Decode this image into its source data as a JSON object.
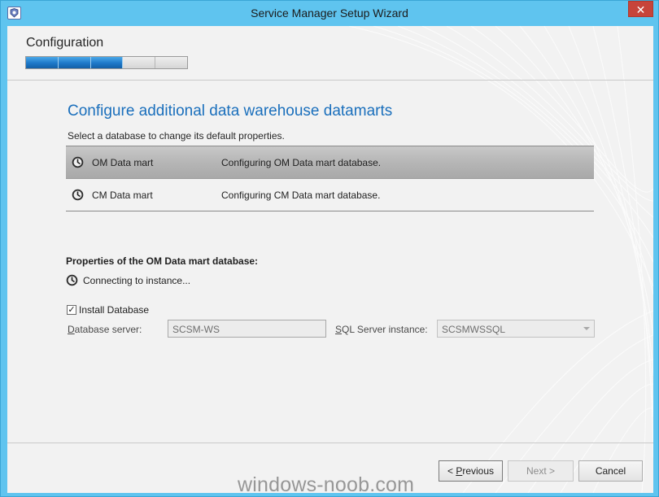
{
  "window": {
    "title": "Service Manager Setup Wizard",
    "close_glyph": "✕",
    "accent_color": "#5fc4ef",
    "icon": "service-manager-app-icon"
  },
  "header": {
    "step_label": "Configuration",
    "progress": {
      "completed_steps": 3,
      "total_steps": 5,
      "fill_color": "#1d78c9"
    }
  },
  "main": {
    "title": "Configure additional data warehouse datamarts",
    "description": "Select a database to change its default properties.",
    "datamarts": [
      {
        "name": "OM Data mart",
        "status": "Configuring OM Data mart database.",
        "icon": "clock-icon",
        "selected": true
      },
      {
        "name": "CM Data mart",
        "status": "Configuring CM Data mart database.",
        "icon": "clock-icon",
        "selected": false
      }
    ],
    "properties": {
      "title": "Properties of the OM Data mart database:",
      "connecting_text": "Connecting to instance...",
      "install_database_label": "Install Database",
      "install_database_checked": true,
      "database_server": {
        "label_underlined": "D",
        "label_rest": "atabase server:",
        "value": "SCSM-WS"
      },
      "sql_server_instance": {
        "label_underlined": "S",
        "label_rest": "QL Server instance:",
        "value": "SCSMWSSQL"
      }
    }
  },
  "footer": {
    "previous": {
      "prefix": "< ",
      "underlined": "P",
      "rest": "revious"
    },
    "next_label": "Next >",
    "cancel_label": "Cancel"
  },
  "watermark": "windows-noob.com"
}
